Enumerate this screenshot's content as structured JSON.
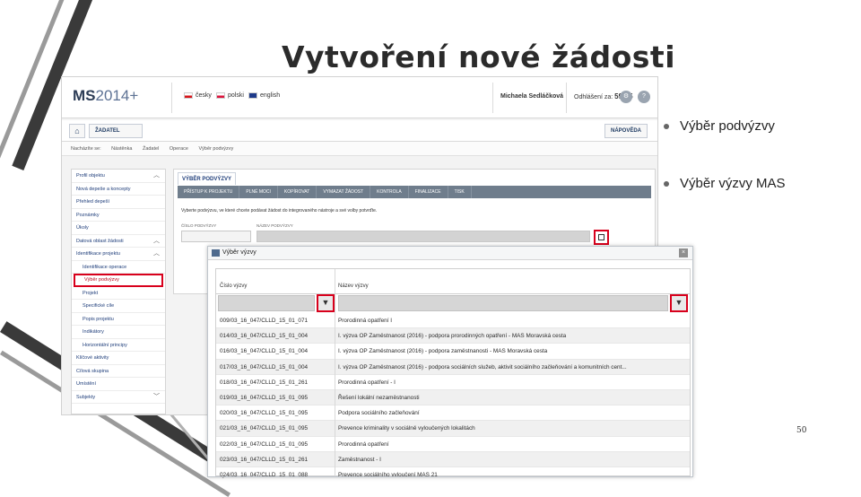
{
  "slide": {
    "title": "Vytvoření nové žádosti",
    "bullets": [
      "Výběr podvýzvy",
      "Výběr výzvy MAS"
    ],
    "page_number": "50"
  },
  "app": {
    "logo_a": "MS",
    "logo_b": "2014+",
    "languages": [
      {
        "label": "česky",
        "flag": "cz"
      },
      {
        "label": "polski",
        "flag": "pl"
      },
      {
        "label": "english",
        "flag": "gb"
      }
    ],
    "user_name": "Michaela Sedláčková",
    "logout_label": "Odhlášení za:",
    "logout_time": "59:55",
    "nav": {
      "home_icon": "home-icon",
      "zadatel": "ŽADATEL",
      "napoveda": "NÁPOVĚDA"
    },
    "breadcrumb": [
      "Nacházíte se:",
      "Nástěnka",
      "Žadatel",
      "Operace",
      "Výběr podvýzvy"
    ],
    "sidebar": [
      {
        "label": "Profil objektu",
        "type": "head",
        "chev": "︿"
      },
      {
        "label": "Nová depeše a koncepty",
        "type": "item"
      },
      {
        "label": "Přehled depeší",
        "type": "item"
      },
      {
        "label": "Poznámky",
        "type": "item"
      },
      {
        "label": "Úkoly",
        "type": "item"
      },
      {
        "label": "Datová oblast žádosti",
        "type": "head",
        "chev": "︿"
      },
      {
        "label": "Identifikace projektu",
        "type": "head",
        "chev": "︿"
      },
      {
        "label": "Identifikace operace",
        "type": "sub"
      },
      {
        "label": "Výběr podvýzvy",
        "type": "sub-hl"
      },
      {
        "label": "Projekt",
        "type": "sub"
      },
      {
        "label": "Specifické cíle",
        "type": "sub"
      },
      {
        "label": "Popis projektu",
        "type": "sub"
      },
      {
        "label": "Indikátory",
        "type": "sub"
      },
      {
        "label": "Horizontální principy",
        "type": "sub"
      },
      {
        "label": "Klíčové aktivity",
        "type": "item"
      },
      {
        "label": "Cílová skupina",
        "type": "item"
      },
      {
        "label": "Umístění",
        "type": "item"
      },
      {
        "label": "Subjekty",
        "type": "head",
        "chev": "﹀"
      }
    ],
    "main": {
      "tab_title": "VÝBĚR PODVÝZVY",
      "toolbar": [
        "PŘÍSTUP K PROJEKTU",
        "PLNÉ MOCI",
        "KOPÍROVAT",
        "VYMAZAT ŽÁDOST",
        "KONTROLA",
        "FINALIZACE",
        "TISK"
      ],
      "info_text": "Vyberte podvýzvu, ve které chcete podávat žádost do integrovaného nástroje a své volby potvrďte.",
      "label_cislo": "ČÍSLO PODVÝZVY",
      "label_nazev": "NÁZEV PODVÝZVY"
    }
  },
  "popup": {
    "title": "Výběr výzvy",
    "close": "×",
    "col1": "Číslo výzvy",
    "col2": "Název výzvy",
    "filter_icon": "▼",
    "rows": [
      {
        "cislo": "009/03_16_047/CLLD_15_01_071",
        "nazev": "Prorodinná opatření I"
      },
      {
        "cislo": "014/03_16_047/CLLD_15_01_004",
        "nazev": "I. výzva OP Zaměstnanost (2016) - podpora prorodinných opatření - MAS Moravská cesta"
      },
      {
        "cislo": "016/03_16_047/CLLD_15_01_004",
        "nazev": "I. výzva OP Zaměstnanost (2016) - podpora zaměstnanosti - MAS Moravská cesta"
      },
      {
        "cislo": "017/03_16_047/CLLD_15_01_004",
        "nazev": "I. výzva OP Zaměstnanost (2016) - podpora sociálních služeb, aktivit sociálního začleňování a komunitních cent..."
      },
      {
        "cislo": "018/03_16_047/CLLD_15_01_261",
        "nazev": "Prorodinná opatření - I"
      },
      {
        "cislo": "019/03_16_047/CLLD_15_01_095",
        "nazev": "Řešení lokální nezaměstnanosti"
      },
      {
        "cislo": "020/03_16_047/CLLD_15_01_095",
        "nazev": "Podpora sociálního začleňování"
      },
      {
        "cislo": "021/03_16_047/CLLD_15_01_095",
        "nazev": "Prevence kriminality v sociálně vyloučených lokalitách"
      },
      {
        "cislo": "022/03_16_047/CLLD_15_01_095",
        "nazev": "Prorodinná opatření"
      },
      {
        "cislo": "023/03_16_047/CLLD_15_01_261",
        "nazev": "Zaměstnanost - I"
      },
      {
        "cislo": "024/03_16_047/CLLD_15_01_088",
        "nazev": "Prevence sociálního vyloučení MAS 21"
      }
    ]
  },
  "colors": {
    "highlight": "#d8001c",
    "nav_text": "#1e3d7a",
    "toolbar": "#6f7d8c"
  }
}
